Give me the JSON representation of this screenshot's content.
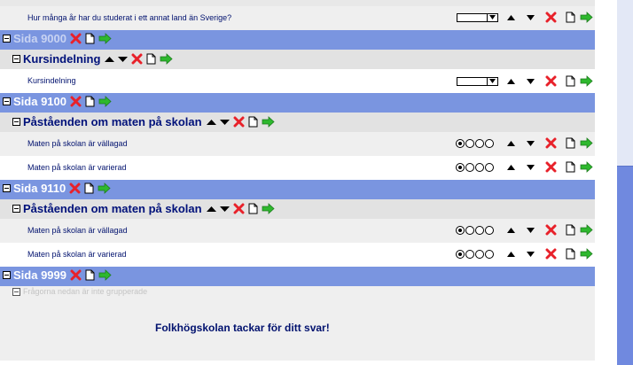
{
  "colors": {
    "page_header_bg": "#7a95e0",
    "group_header_bg": "#e2e2e2",
    "question_text": "#00116e",
    "delete_icon": "#e8212a",
    "forward_icon": "#2eb82e",
    "scroll_thumb": "#7089df"
  },
  "questions": {
    "studied_abroad": "Hur många år har du studerat i ett annat land än Sverige?",
    "course_intro": "Kursindelning",
    "food_tasty": "Maten på skolan är vällagad",
    "food_varied": "Maten på skolan är varierad"
  },
  "pages": {
    "p9000": {
      "title": "Sida 9000",
      "group_title": "Kursindelning"
    },
    "p9100": {
      "title": "Sida 9100",
      "group_title": "Påståenden om maten på skolan"
    },
    "p9110": {
      "title": "Sida 9110",
      "group_title": "Påståenden om maten på skolan"
    },
    "p9999": {
      "title": "Sida 9999",
      "note": "Frågorna nedan är inte grupperade"
    }
  },
  "thanks": "Folkhögskolan tackar för ditt svar!",
  "icons": [
    "expand-collapse-icon",
    "delete-icon",
    "document-icon",
    "forward-arrow-icon",
    "move-up-icon",
    "move-down-icon",
    "dropdown-arrow-icon"
  ]
}
